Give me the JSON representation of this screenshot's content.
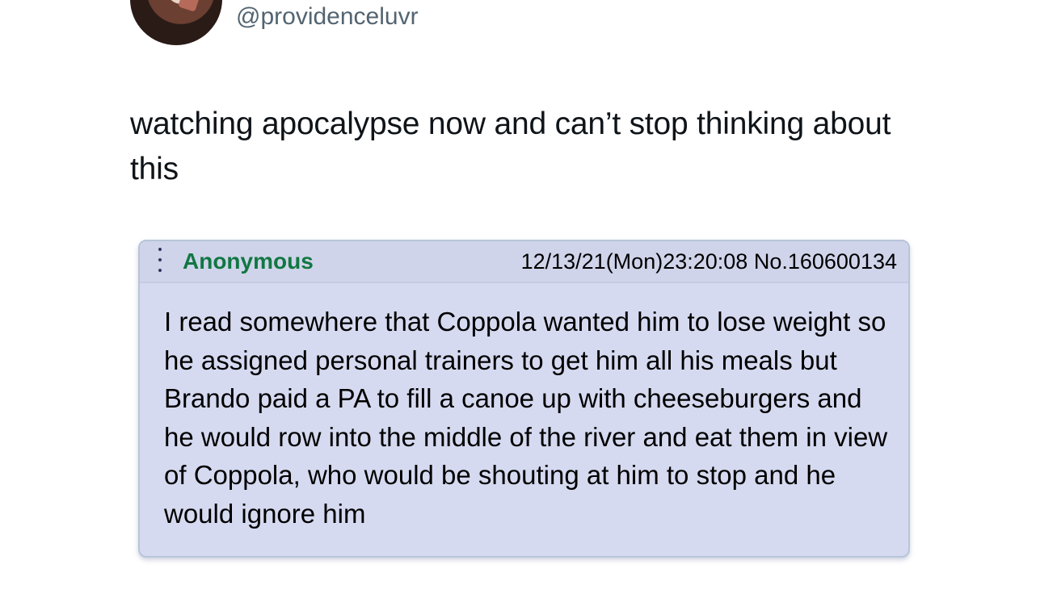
{
  "tweet": {
    "handle": "@providenceluvr",
    "text": "watching apocalypse now and can’t stop thinking about this"
  },
  "post": {
    "menu_icon": "vertical-dots-icon",
    "name": "Anonymous",
    "datetime": "12/13/21(Mon)23:20:08",
    "number": "No.160600134",
    "body": "I read somewhere that Coppola wanted him to lose weight so he assigned personal trainers to get him all his meals but Brando paid a PA to fill a canoe up with cheeseburgers and he would row into the middle of the river and eat them in view of Coppola, who would be shouting at him to stop and he would ignore him"
  },
  "colors": {
    "post_background": "#d6daf0",
    "poster_name": "#117743",
    "handle": "#536471"
  }
}
